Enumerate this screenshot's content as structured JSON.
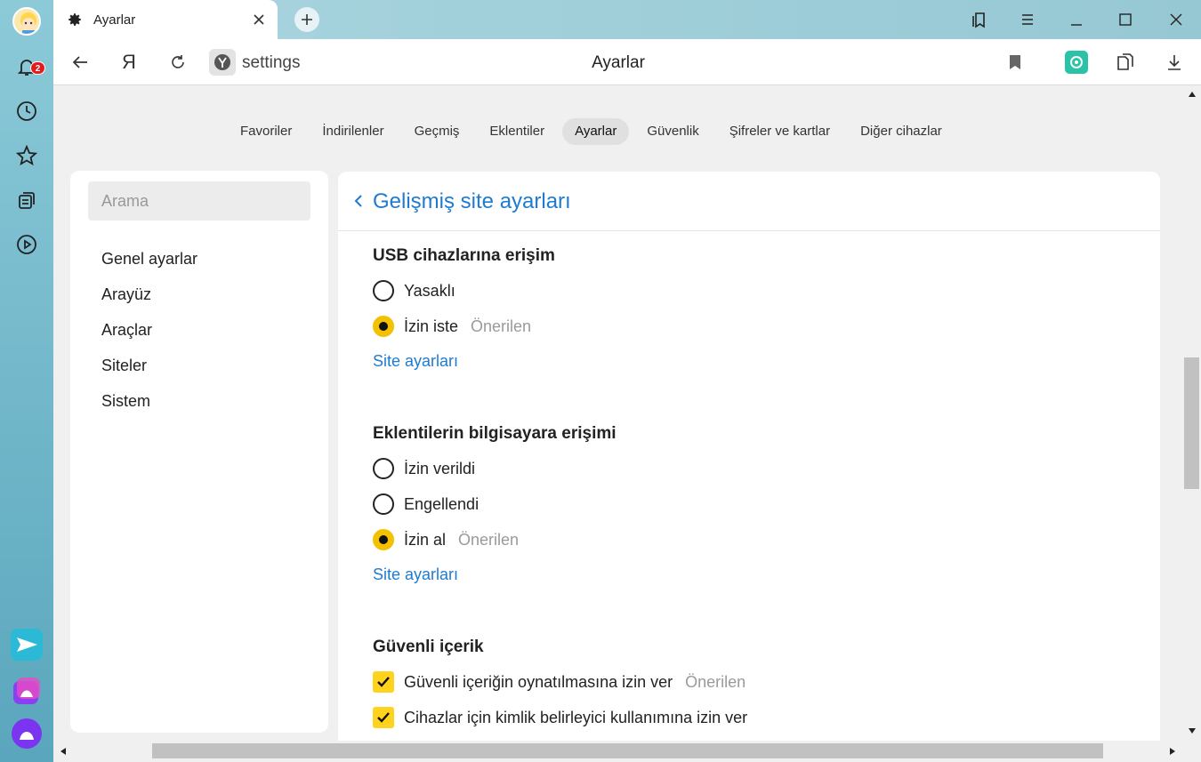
{
  "rail": {
    "notification_count": "2",
    "icons": [
      "bell-icon",
      "clock-icon",
      "star-icon",
      "collections-icon",
      "play-icon",
      "messenger-icon",
      "gallery-icon",
      "alice-icon"
    ]
  },
  "tab": {
    "title": "Ayarlar"
  },
  "address": {
    "url": "settings",
    "page_title": "Ayarlar",
    "ya_glyph": "Я"
  },
  "topnav": [
    {
      "label": "Favoriler"
    },
    {
      "label": "İndirilenler"
    },
    {
      "label": "Geçmiş"
    },
    {
      "label": "Eklentiler"
    },
    {
      "label": "Ayarlar",
      "active": true
    },
    {
      "label": "Güvenlik"
    },
    {
      "label": "Şifreler ve kartlar"
    },
    {
      "label": "Diğer cihazlar"
    }
  ],
  "sidebar": {
    "search_placeholder": "Arama",
    "items": [
      {
        "label": "Genel ayarlar"
      },
      {
        "label": "Arayüz"
      },
      {
        "label": "Araçlar"
      },
      {
        "label": "Siteler"
      },
      {
        "label": "Sistem"
      }
    ]
  },
  "main": {
    "title": "Gelişmiş site ayarları",
    "usb": {
      "title": "USB cihazlarına erişim",
      "options": [
        {
          "label": "Yasaklı",
          "checked": false,
          "hint": ""
        },
        {
          "label": "İzin iste",
          "checked": true,
          "hint": "Önerilen"
        }
      ],
      "link": "Site ayarları"
    },
    "extensions": {
      "title": "Eklentilerin bilgisayara erişimi",
      "options": [
        {
          "label": "İzin verildi",
          "checked": false,
          "hint": ""
        },
        {
          "label": "Engellendi",
          "checked": false,
          "hint": ""
        },
        {
          "label": "İzin al",
          "checked": true,
          "hint": "Önerilen"
        }
      ],
      "link": "Site ayarları"
    },
    "protected": {
      "title": "Güvenli içerik",
      "options": [
        {
          "label": "Güvenli içeriğin oynatılmasına izin ver",
          "checked": true,
          "hint": "Önerilen"
        },
        {
          "label": "Cihazlar için kimlik belirleyici kullanımına izin ver",
          "checked": true,
          "hint": ""
        }
      ]
    }
  },
  "colors": {
    "accent": "#1f7bd1",
    "radio_selected": "#f2c200",
    "checkbox": "#ffd21e",
    "hint": "#9a9a9a",
    "rail": "#6fb8cc"
  }
}
